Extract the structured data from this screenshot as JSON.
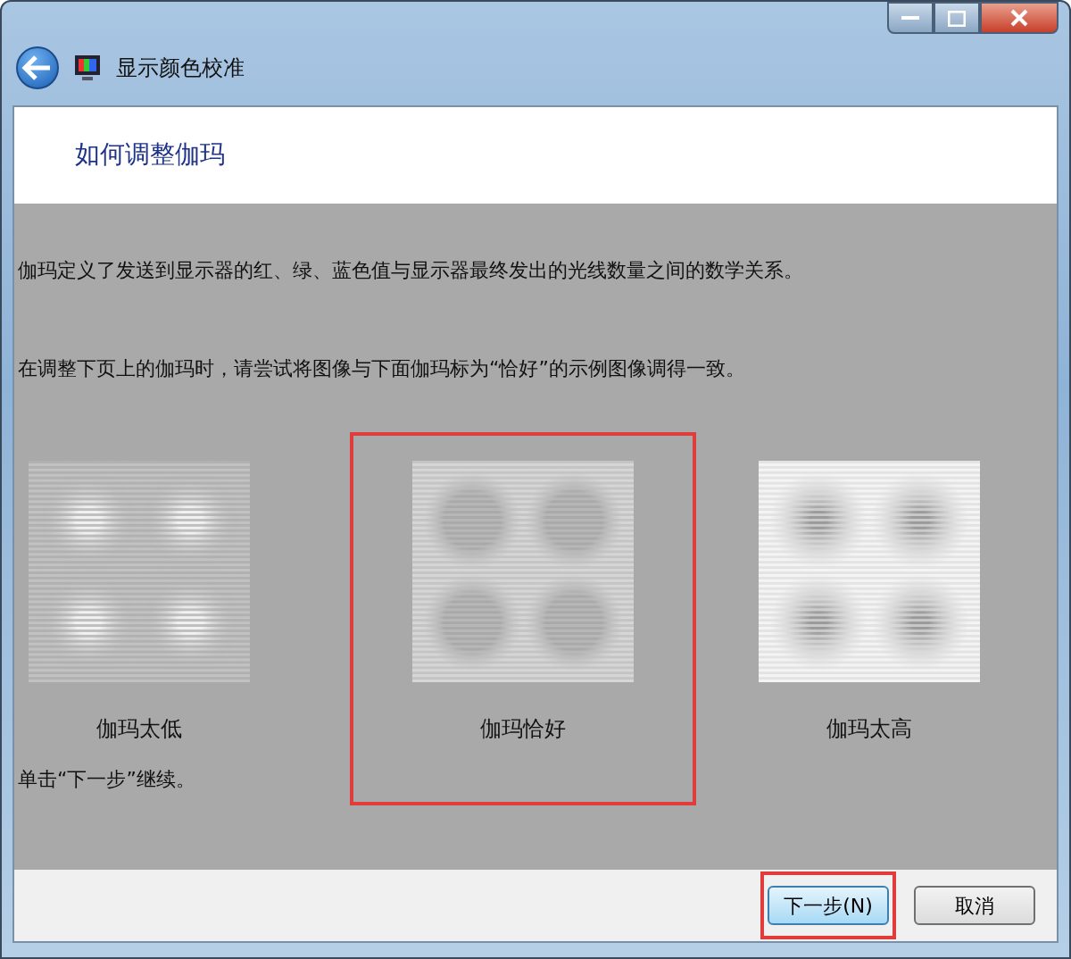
{
  "window": {
    "title": "显示颜色校准"
  },
  "header": {
    "title": "如何调整伽玛"
  },
  "paragraphs": [
    "伽玛定义了发送到显示器的红、绿、蓝色值与显示器最终发出的光线数量之间的数学关系。",
    "在调整下页上的伽玛时，请尝试将图像与下面伽玛标为“恰好”的示例图像调得一致。"
  ],
  "samples": [
    {
      "kind": "low",
      "label": "伽玛太低",
      "highlighted": false
    },
    {
      "kind": "good",
      "label": "伽玛恰好",
      "highlighted": true
    },
    {
      "kind": "high",
      "label": "伽玛太高",
      "highlighted": false
    }
  ],
  "instruction": "单击“下一步”继续。",
  "buttons": [
    {
      "label": "下一步(N)",
      "highlighted": true
    },
    {
      "label": "取消",
      "highlighted": false
    }
  ]
}
